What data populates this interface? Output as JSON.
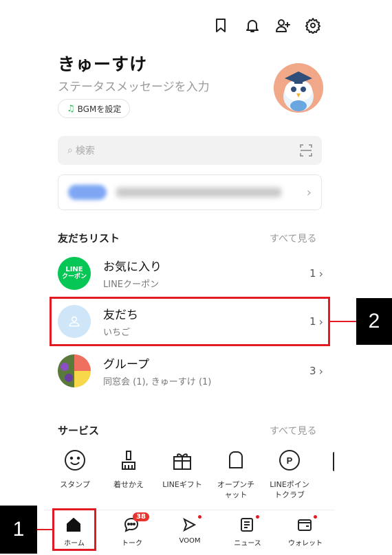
{
  "header": {
    "icons": [
      "bookmark-icon",
      "bell-icon",
      "add-friend-icon",
      "settings-icon"
    ]
  },
  "profile": {
    "name": "きゅーすけ",
    "status_message": "ステータスメッセージを入力",
    "bgm_label": "BGMを設定"
  },
  "search": {
    "placeholder": "検索"
  },
  "friends_section": {
    "title": "友だちリスト",
    "see_all": "すべて見る",
    "rows": [
      {
        "title": "お気に入り",
        "subtitle": "LINEクーポン",
        "count": "1",
        "thumb_text": "LINE\nクーポン"
      },
      {
        "title": "友だち",
        "subtitle": "いちご",
        "count": "1"
      },
      {
        "title": "グループ",
        "subtitle": "同窓会 (1), きゅーすけ (1)",
        "count": "3"
      }
    ]
  },
  "services_section": {
    "title": "サービス",
    "see_all": "すべて見る",
    "items": [
      {
        "label": "スタンプ",
        "icon": "smiley-icon"
      },
      {
        "label": "着せかえ",
        "icon": "brush-icon"
      },
      {
        "label": "LINEギフト",
        "icon": "gift-icon"
      },
      {
        "label": "オープンチ\nャット",
        "icon": "open-chat-icon"
      },
      {
        "label": "LINEポイン\nトクラブ",
        "icon": "points-icon"
      }
    ]
  },
  "bottom_nav": {
    "items": [
      {
        "label": "ホーム",
        "icon": "home-icon"
      },
      {
        "label": "トーク",
        "icon": "talk-icon",
        "badge": "38"
      },
      {
        "label": "VOOM",
        "icon": "voom-icon"
      },
      {
        "label": "ニュース",
        "icon": "news-icon"
      },
      {
        "label": "ウォレット",
        "icon": "wallet-icon"
      }
    ]
  },
  "annotations": {
    "callout_1": "1",
    "callout_2": "2"
  },
  "colors": {
    "line_green": "#06c755",
    "highlight_red": "#e01b24",
    "badge_red": "#e8342f"
  }
}
